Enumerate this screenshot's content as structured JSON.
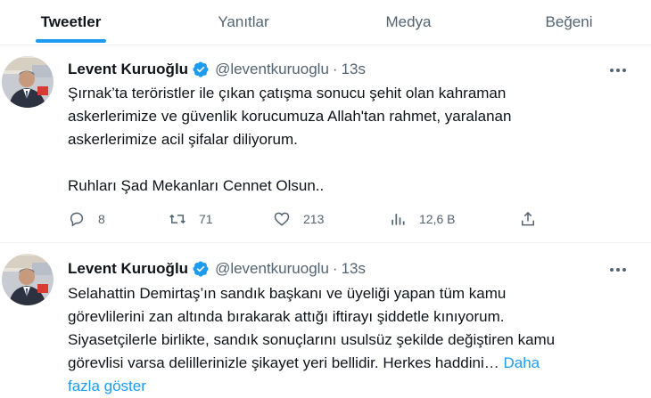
{
  "tabs": [
    {
      "label": "Tweetler"
    },
    {
      "label": "Yanıtlar"
    },
    {
      "label": "Medya"
    },
    {
      "label": "Beğeni"
    }
  ],
  "tweets": [
    {
      "name": "Levent Kuruoğlu",
      "handle": "@leventkuruoglu",
      "separator": "·",
      "time": "13s",
      "text": "Şırnak’ta teröristler ile çıkan çatışma sonucu şehit olan kahraman\naskerlerimize ve güvenlik korucumuza Allah'tan rahmet, yaralanan\naskerlerimize acil şifalar diliyorum.\n\nRuhları Şad Mekanları Cennet Olsun..",
      "replies": "8",
      "retweets": "71",
      "likes": "213",
      "views": "12,6 B"
    },
    {
      "name": "Levent Kuruoğlu",
      "handle": "@leventkuruoglu",
      "separator": "·",
      "time": "13s",
      "text": "Selahattin Demirtaş’ın sandık başkanı ve üyeliği yapan tüm kamu\ngörevlilerini zan altında bırakarak attığı iftirayı şiddetle kınıyorum.\nSiyasetçilerle birlikte, sandık sonuçlarını usulsüz şekilde değiştiren kamu\ngörevlisi varsa delillerinizle şikayet yeri bellidir. Herkes haddini… ",
      "show_more": "Daha\nfazla göster"
    }
  ],
  "colors": {
    "accent": "#1d9bf0",
    "text_primary": "#0f1419",
    "text_secondary": "#536471",
    "divider": "#eff3f4"
  },
  "icons": {
    "verified": "verified-badge-icon",
    "more": "more-options-icon",
    "reply": "reply-icon",
    "retweet": "retweet-icon",
    "like": "heart-icon",
    "views": "views-chart-icon",
    "share": "share-icon"
  }
}
